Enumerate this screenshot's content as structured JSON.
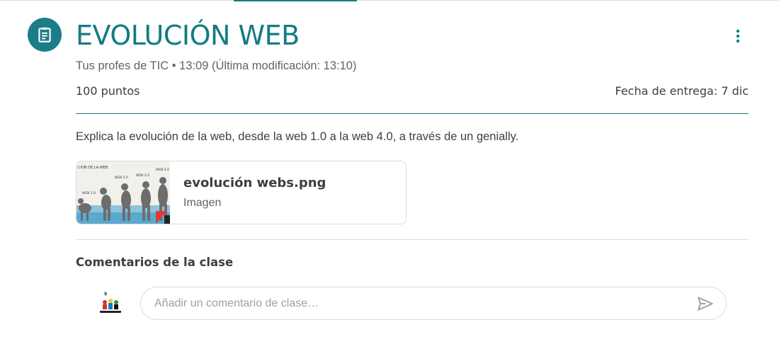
{
  "assignment": {
    "title": "EVOLUCIÓN WEB",
    "author": "Tus profes de TIC",
    "separator": " • ",
    "time": "13:09",
    "modified": " (Última modificación: 13:10)",
    "points": "100 puntos",
    "due_date": "Fecha de entrega: 7 dic",
    "description": "Explica la evolución de la web, desde la web 1.0 a la web 4.0, a través de un genially."
  },
  "attachment": {
    "name": "evolución webs.png",
    "type": "Imagen",
    "thumbnail_labels": [
      "CION DE LA WEB",
      "WEB 2.0",
      "WEB 3.0",
      "WEB 4.0",
      "WEB 1.0"
    ]
  },
  "comments": {
    "heading": "Comentarios de la clase",
    "placeholder": "Añadir un comentario de clase…"
  },
  "colors": {
    "accent": "#137b84",
    "icon_bg": "#1a7e88",
    "text": "#3c4043",
    "secondary_text": "#5f6368",
    "border": "#dadce0"
  },
  "icons": {
    "assignment": "assignment-icon",
    "more": "more-vert-icon",
    "send": "send-icon"
  }
}
